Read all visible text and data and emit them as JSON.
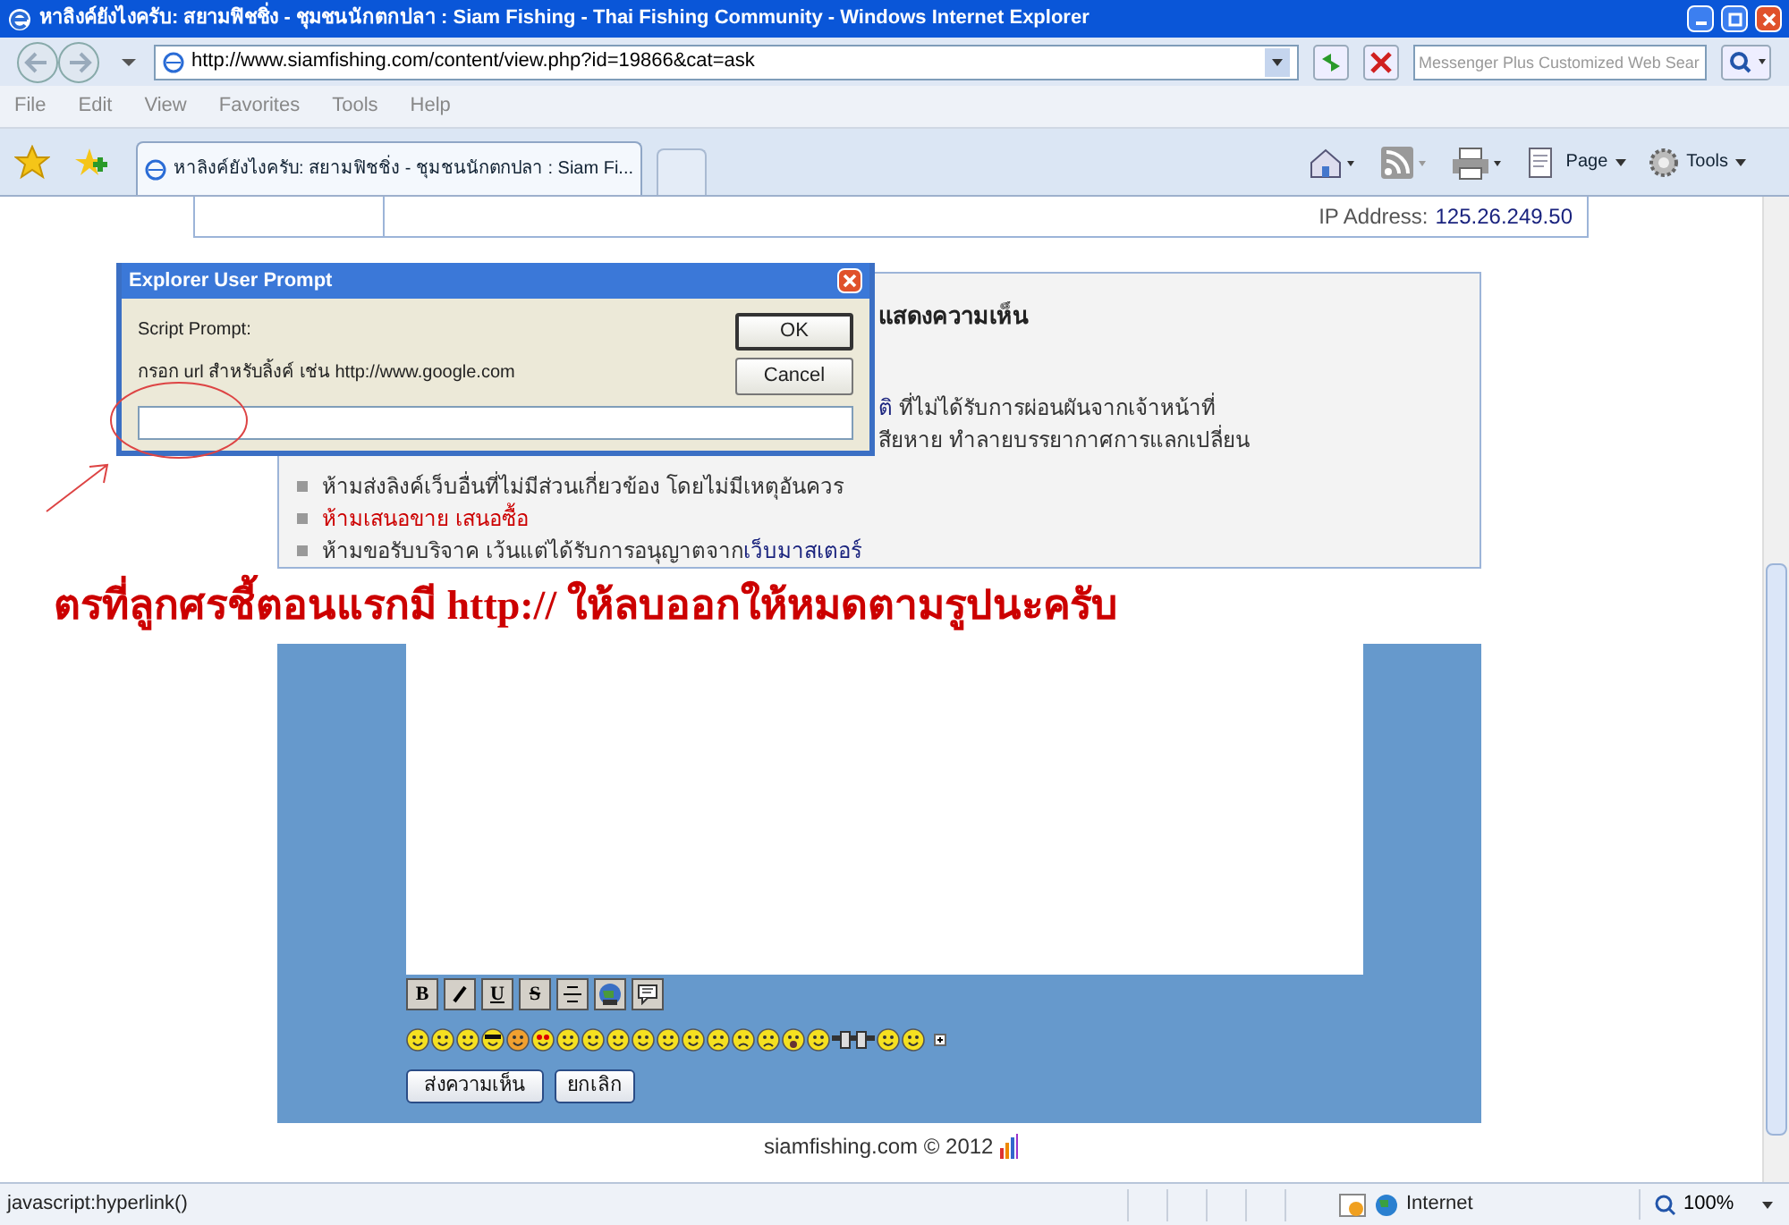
{
  "window": {
    "title": "หาลิงค์ยังไงครับ: สยามฟิชชิ่ง - ชุมชนนักตกปลา : Siam Fishing - Thai Fishing Community - Windows Internet Explorer"
  },
  "address_bar": {
    "url": "http://www.siamfishing.com/content/view.php?id=19866&cat=ask"
  },
  "search": {
    "placeholder": "Messenger Plus Customized Web Sear"
  },
  "menu": [
    "File",
    "Edit",
    "View",
    "Favorites",
    "Tools",
    "Help"
  ],
  "tabs": [
    {
      "label": "หาลิงค์ยังไงครับ: สยามฟิชชิ่ง - ชุมชนนักตกปลา : Siam Fi...",
      "selected": true
    }
  ],
  "command_bar": [
    "Page",
    "Tools"
  ],
  "page": {
    "ip_label": "IP Address:",
    "ip_value": "125.26.249.50",
    "rules_heading": "แสดงความเห็น",
    "rules": [
      {
        "kind": "link_start",
        "link": "ติ",
        "text": " ที่ไม่ได้รับการผ่อนผันจากเจ้าหน้าที่"
      },
      {
        "kind": "plain",
        "text": "สียหาย ทำลายบรรยากาศการแลกเปลี่ยน"
      },
      {
        "kind": "bullet",
        "text": "ห้ามส่งลิงค์เว็บอื่นที่ไม่มีส่วนเกี่ยวข้อง โดยไม่มีเหตุอันควร",
        "color": "#333333"
      },
      {
        "kind": "bullet",
        "text": "ห้ามเสนอขาย เสนอซื้อ",
        "color": "#cc0000"
      },
      {
        "kind": "bullet_link",
        "text": "ห้ามขอรับบริจาค เว้นแต่ได้รับการอนุญาตจาก ",
        "link": "เว็บมาสเตอร์",
        "color": "#333333"
      }
    ],
    "format_buttons": [
      {
        "kind": "bold",
        "label": "B"
      },
      {
        "kind": "italic"
      },
      {
        "kind": "underline",
        "label": "U"
      },
      {
        "kind": "strike",
        "label": "S"
      },
      {
        "kind": "center"
      },
      {
        "kind": "link"
      },
      {
        "kind": "quote"
      }
    ],
    "smileys": [
      {
        "kind": "smile"
      },
      {
        "kind": "grin"
      },
      {
        "kind": "laugh"
      },
      {
        "kind": "cool"
      },
      {
        "kind": "blush"
      },
      {
        "kind": "love"
      },
      {
        "kind": "smile"
      },
      {
        "kind": "tongue"
      },
      {
        "kind": "grin"
      },
      {
        "kind": "smile"
      },
      {
        "kind": "smile"
      },
      {
        "kind": "confused"
      },
      {
        "kind": "sad"
      },
      {
        "kind": "sad"
      },
      {
        "kind": "angry"
      },
      {
        "kind": "shock"
      },
      {
        "kind": "smile"
      },
      {
        "kind": "glasses"
      },
      {
        "kind": "smile"
      },
      {
        "kind": "wink"
      }
    ],
    "buttons": [
      "ส่งความเห็น",
      "ยกเลิก"
    ],
    "footer": "siamfishing.com © 2012"
  },
  "dialog": {
    "title": "Explorer User Prompt",
    "label": "Script Prompt:",
    "message": "กรอก url สำหรับลิ้งค์ เช่น http://www.google.com",
    "buttons": [
      "OK",
      "Cancel"
    ]
  },
  "annotation": {
    "text": "ตรที่ลูกศรชี้ตอนแรกมี http:// ให้ลบออกให้หมดตามรูปนะครับ"
  },
  "status_bar": {
    "text": "javascript:hyperlink()",
    "zone": "Internet",
    "zoom": "100%"
  }
}
